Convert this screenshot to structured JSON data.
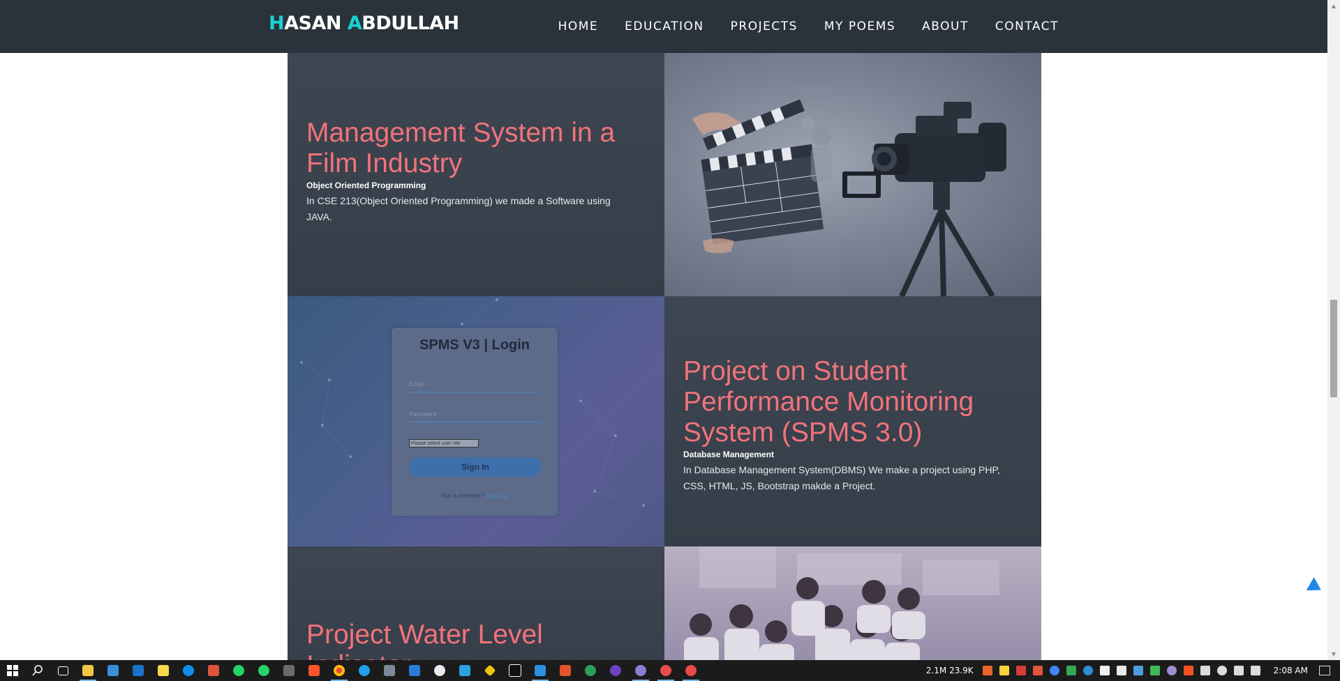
{
  "brand": {
    "first_initial": "H",
    "first_rest": "ASAN ",
    "last_initial": "A",
    "last_rest": "BDULLAH"
  },
  "nav": {
    "items": [
      "HOME",
      "EDUCATION",
      "PROJECTS",
      "MY POEMS",
      "ABOUT",
      "CONTACT"
    ]
  },
  "colors": {
    "nav_bg": "#2a323b",
    "accent": "#17d3d3",
    "title": "#f2737a",
    "card_bg": "#3b434f"
  },
  "projects": [
    {
      "title": "Management System in a Film Industry",
      "subtitle": "Object Oriented Programming",
      "description": "In CSE 213(Object Oriented Programming) we made a Software using JAVA."
    },
    {
      "title": "Project on Student Performance Monitoring System (SPMS 3.0)",
      "subtitle": "Database Management",
      "description": "In Database Management System(DBMS) We make a project using PHP, CSS, HTML, JS, Bootstrap makde a Project."
    },
    {
      "title": "Project Water Level Indicator"
    }
  ],
  "spms_login": {
    "title": "SPMS V3 | Login",
    "email_placeholder": "Email",
    "password_placeholder": "Password",
    "role_select": "Please select user role",
    "sign_in": "Sign In",
    "footer_text": "Not a member?",
    "footer_link": "Sign up"
  },
  "taskbar": {
    "network": "2.1M 23.9K",
    "clock": "2:08 AM"
  }
}
